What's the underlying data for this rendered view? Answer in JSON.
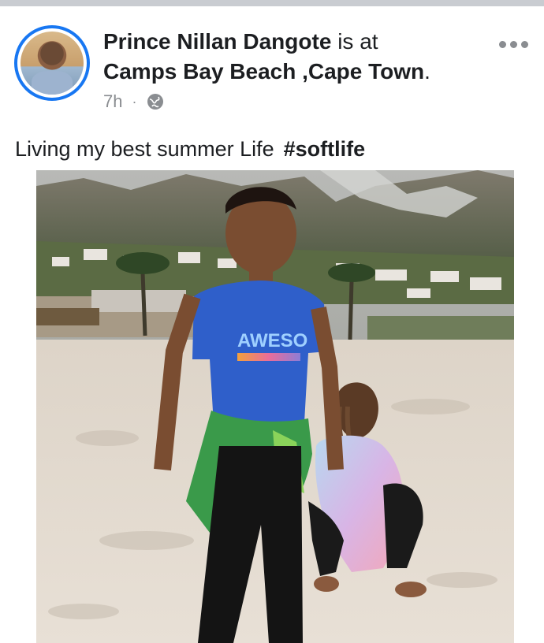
{
  "post": {
    "author": "Prince Nillan Dangote",
    "connector": "is at",
    "location": "Camps Bay Beach ,Cape Town",
    "location_suffix": ".",
    "time": "7h",
    "separator": "·",
    "privacy_icon": "globe-icon",
    "more_icon": "more-options-icon",
    "caption_text": "Living my best summer Life",
    "hashtag": "#softlife",
    "photo_text": "AWESO"
  },
  "colors": {
    "accent": "#1877f2",
    "meta": "#8a8d91",
    "divider": "#c9ccd1"
  }
}
